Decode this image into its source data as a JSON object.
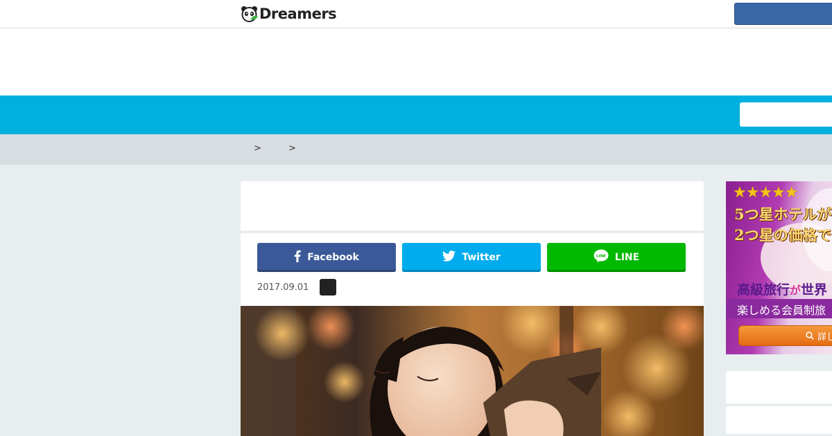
{
  "header": {
    "logo_text": "Dreamers",
    "logo_icon": "panda-icon"
  },
  "breadcrumb": {
    "separators": [
      ">",
      ">"
    ]
  },
  "article": {
    "share": {
      "facebook_label": "Facebook",
      "twitter_label": "Twitter",
      "line_label": "LINE",
      "line_icon_text": "LINE"
    },
    "date": "2017.09.01"
  },
  "sidebar_ad": {
    "stars": "★★★★★",
    "headline_1": "5つ星ホテルが",
    "headline_2": "2つ星の価格で",
    "sub_headline": "高級旅行",
    "sub_headline_particle": "が",
    "sub_headline_tail": "世界",
    "tagline": "楽しめる会員制旅",
    "button_label": "詳し"
  },
  "colors": {
    "nav_bar": "#00b1e0",
    "facebook": "#3b5998",
    "twitter": "#00aced",
    "line": "#00b900",
    "header_button": "#3a67a8"
  }
}
